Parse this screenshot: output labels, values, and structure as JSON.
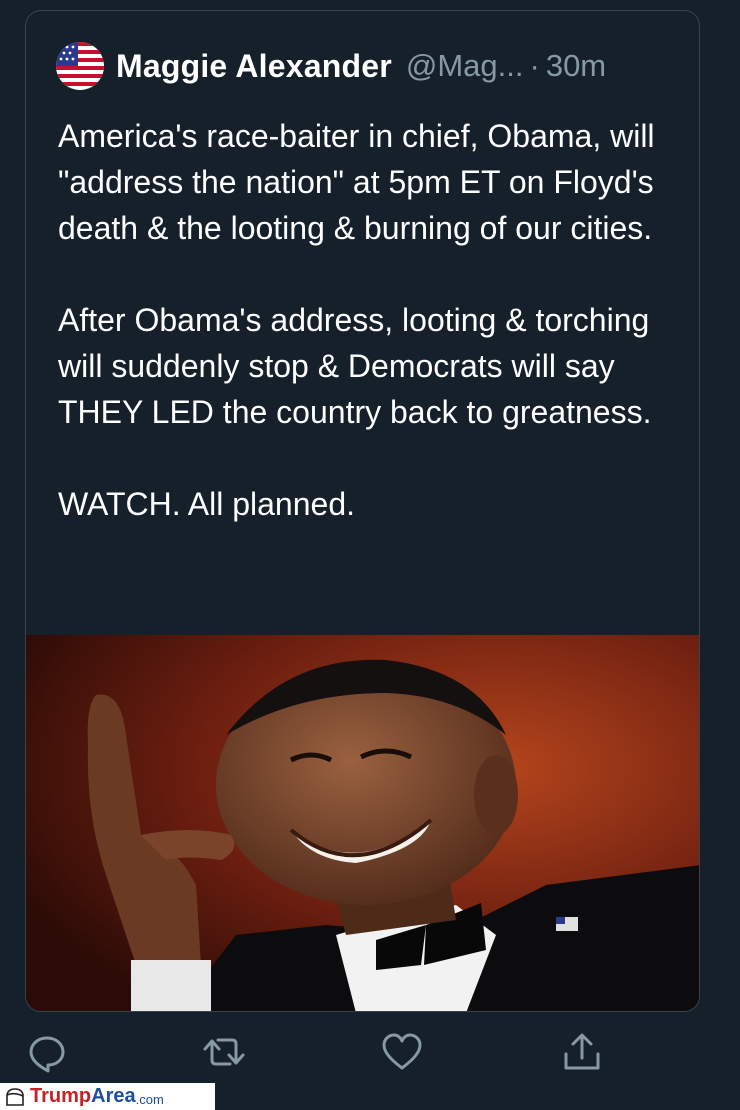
{
  "tweet": {
    "author_name": "Maggie Alexander",
    "author_handle": "@Mag...",
    "separator": "·",
    "timestamp": "30m",
    "avatar_icon": "us-flag-icon",
    "text": "America's race-baiter in chief, Obama, will \"address the nation\" at 5pm ET on Floyd's death & the looting & burning of our cities.\n\nAfter Obama's address, looting & torching will suddenly stop & Democrats will say THEY LED the country back to greatness.\n\nWATCH. All planned.",
    "media": {
      "icon": "photo-obama-laughing"
    }
  },
  "actions": [
    {
      "name": "reply",
      "icon": "reply-icon"
    },
    {
      "name": "retweet",
      "icon": "retweet-icon"
    },
    {
      "name": "like",
      "icon": "heart-icon"
    },
    {
      "name": "share",
      "icon": "share-icon"
    }
  ],
  "watermark": {
    "part1": "Trump",
    "part2": "Area",
    "part3": ".com"
  },
  "colors": {
    "background": "#15202b",
    "border": "#38444d",
    "secondary_text": "#8899a6",
    "icon": "#8899a6"
  }
}
